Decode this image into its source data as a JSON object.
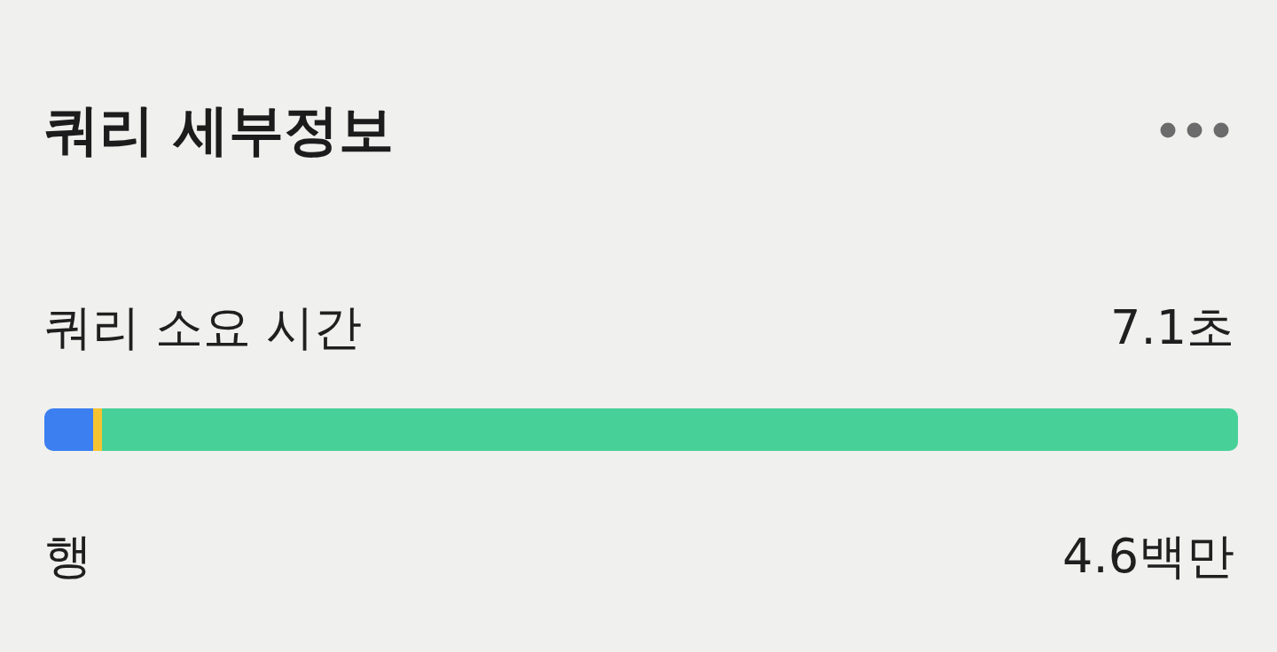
{
  "header": {
    "title": "쿼리 세부정보"
  },
  "duration": {
    "label": "쿼리 소요 시간",
    "value": "7.1초"
  },
  "breakdown_bar": {
    "segments": [
      {
        "color": "#3b7ff0",
        "level": 0.041
      },
      {
        "color": "#f5c332",
        "level": 0.007
      },
      {
        "color": "#47d198",
        "level": 0.952
      }
    ]
  },
  "rows": {
    "label": "행",
    "value": "4.6백만"
  }
}
